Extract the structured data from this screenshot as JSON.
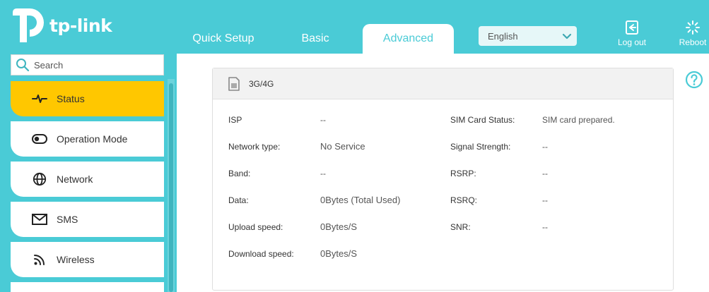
{
  "header": {
    "brand": "tp-link",
    "tabs": [
      {
        "label": "Quick Setup"
      },
      {
        "label": "Basic"
      },
      {
        "label": "Advanced"
      }
    ],
    "language": "English",
    "logout_label": "Log out",
    "reboot_label": "Reboot"
  },
  "search": {
    "placeholder": "Search"
  },
  "sidebar": {
    "items": [
      {
        "label": "Status",
        "icon": "pulse-icon",
        "active": true
      },
      {
        "label": "Operation Mode",
        "icon": "toggle-icon"
      },
      {
        "label": "Network",
        "icon": "globe-icon"
      },
      {
        "label": "SMS",
        "icon": "envelope-icon"
      },
      {
        "label": "Wireless",
        "icon": "wifi-icon"
      }
    ]
  },
  "panel": {
    "title": "3G/4G",
    "left": [
      {
        "label": "ISP",
        "value": "--"
      },
      {
        "label": "Network type:",
        "value": "No Service"
      },
      {
        "label": "Band:",
        "value": "--"
      },
      {
        "label": "Data:",
        "value": "0Bytes (Total Used)"
      },
      {
        "label": "Upload speed:",
        "value": "0Bytes/S"
      },
      {
        "label": "Download speed:",
        "value": "0Bytes/S"
      }
    ],
    "right": [
      {
        "label": "SIM Card Status:",
        "value": "SIM card prepared."
      },
      {
        "label": "Signal Strength:",
        "value": "--"
      },
      {
        "label": "RSRP:",
        "value": "--"
      },
      {
        "label": "RSRQ:",
        "value": "--"
      },
      {
        "label": "SNR:",
        "value": "--"
      }
    ]
  },
  "colors": {
    "accent": "#4acbd6",
    "active_nav": "#ffc700"
  }
}
